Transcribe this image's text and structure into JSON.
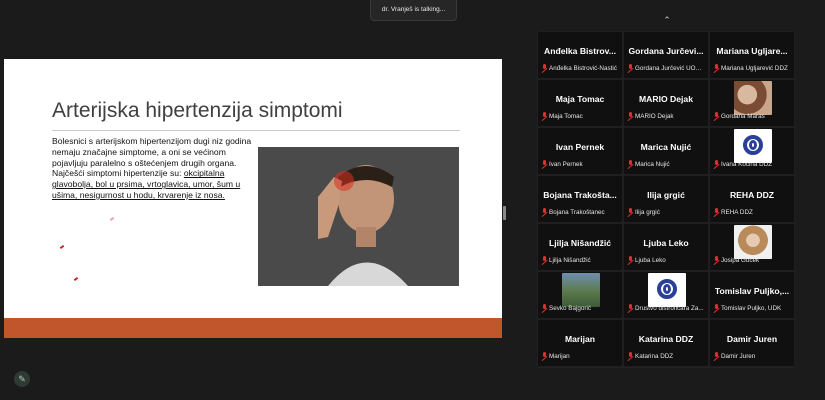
{
  "notification": {
    "talking_text": "dr. Vranješ is talking..."
  },
  "slide": {
    "title": "Arterijska hipertenzija simptomi",
    "body_intro": "Bolesnici s arterijskom hipertenzijom dugi niz godina nemaju značajne simptome, a oni se većinom pojavljuju paralelno s oštećenjem drugih organa. Najčešći simptomi hipertenzije su: ",
    "body_underlined": "okcipitalna glavobolja, bol u prsima, vrtoglavica, umor, šum u ušima, nesigurnost u hodu, krvarenje iz nosa.",
    "bar_color": "#c1552b"
  },
  "gallery": {
    "tiles": [
      {
        "name": "Anđelka Bistrov...",
        "label": "Anđelka Bistrović-Nastić",
        "avatar": ""
      },
      {
        "name": "Gordana Jurčevi...",
        "label": "Gordana Jurčević UOSI...",
        "avatar": ""
      },
      {
        "name": "Mariana Ugljare...",
        "label": "Mariana Ugljarević DDZ",
        "avatar": ""
      },
      {
        "name": "Maja Tomac",
        "label": "Maja Tomac",
        "avatar": ""
      },
      {
        "name": "MARIO Dejak",
        "label": "MARIO Dejak",
        "avatar": ""
      },
      {
        "name": "",
        "label": "Gordana Maras",
        "avatar": "photo1"
      },
      {
        "name": "Ivan Pernek",
        "label": "Ivan Pernek",
        "avatar": ""
      },
      {
        "name": "Marica Nujić",
        "label": "Marica Nujić",
        "avatar": ""
      },
      {
        "name": "",
        "label": "Ivana Kočina DDZ",
        "avatar": "logo"
      },
      {
        "name": "Bojana Trakošta...",
        "label": "Bojana Trakoštanec",
        "avatar": ""
      },
      {
        "name": "Ilija grgić",
        "label": "Ilija grgić",
        "avatar": ""
      },
      {
        "name": "REHA DDZ",
        "label": "REHA DDZ",
        "avatar": ""
      },
      {
        "name": "Ljilja Nišandžić",
        "label": "Ljilja Nišandžić",
        "avatar": ""
      },
      {
        "name": "Ljuba Leko",
        "label": "Ljuba Leko",
        "avatar": ""
      },
      {
        "name": "",
        "label": "Josipa Guček",
        "avatar": "photo2"
      },
      {
        "name": "",
        "label": "Ševko Bajgorić",
        "avatar": "photo3"
      },
      {
        "name": "",
        "label": "Drustvo distroficara Za...",
        "avatar": "logo"
      },
      {
        "name": "Tomislav Puljko,...",
        "label": "Tomislav Puljko, UDK",
        "avatar": ""
      },
      {
        "name": "Marijan",
        "label": "Marijan",
        "avatar": ""
      },
      {
        "name": "Katarina DDZ",
        "label": "Katarina DDZ",
        "avatar": ""
      },
      {
        "name": "Damir Juren",
        "label": "Damir Juren",
        "avatar": ""
      }
    ]
  },
  "icons": {
    "collapse": "chevron-up-icon",
    "muted": "mic-muted-icon",
    "edit": "pencil-icon"
  },
  "colors": {
    "muted_red": "#e0302e",
    "background": "#1b1b1b"
  }
}
